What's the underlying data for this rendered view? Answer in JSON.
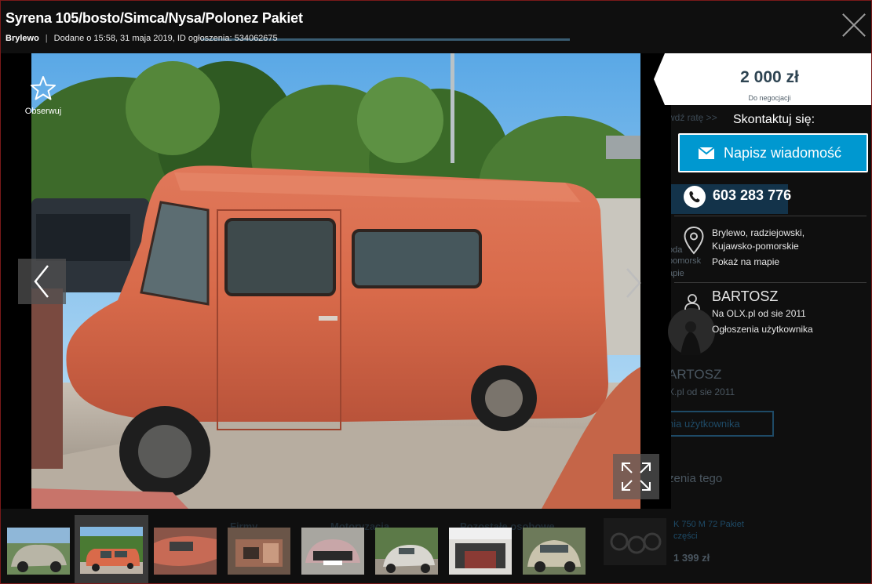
{
  "header": {
    "title": "Syrena 105/bosto/Simca/Nysa/Polonez Pakiet",
    "location": "Brylewo",
    "separator": "|",
    "meta": "Dodane o 15:58, 31 maja 2019, ID ogłoszenia: 534062675"
  },
  "actions": {
    "observe_label": "Obserwuj"
  },
  "price": {
    "value": "2 000 zł",
    "note": "Do negocjacji"
  },
  "contact": {
    "label": "Skontaktuj się:",
    "message_button": "Napisz wiadomość",
    "phone": "603 283 776"
  },
  "location": {
    "line1": "Brylewo, radziejowski,",
    "line2": "Kujawsko-pomorskie",
    "map_link": "Pokaż na mapie"
  },
  "user": {
    "name": "BARTOSZ",
    "since": "Na OLX.pl od sie 2011",
    "ads_link": "Ogłoszenia użytkownika"
  },
  "background": {
    "rate_link": "wdź ratę >>",
    "user_name": "ARTOSZ",
    "user_since": "X.pl od sie 2011",
    "user_ads_button": "nia użytkownika",
    "similar": "zenia tego",
    "tab1": "Firmy",
    "tab2": "Motoryzacja",
    "tab3": "Pozostałe osobowe",
    "ad_title": "K 750 M 72 Pakiet",
    "ad_sub": "części",
    "ad_price": "1 399 zł",
    "loc_ghost_1": "oda",
    "loc_ghost_2": "pomorsk",
    "loc_ghost_3": "apie"
  },
  "icons": {
    "star": "star-outline-icon",
    "close": "close-icon",
    "prev": "chevron-left-icon",
    "next": "chevron-right-icon",
    "fullscreen": "expand-icon",
    "mail": "envelope-icon",
    "phone": "phone-icon",
    "pin": "map-pin-icon",
    "user": "user-icon"
  },
  "colors": {
    "accent": "#0098d0",
    "price_text": "#2e4452",
    "background": "#0f0f0f"
  }
}
